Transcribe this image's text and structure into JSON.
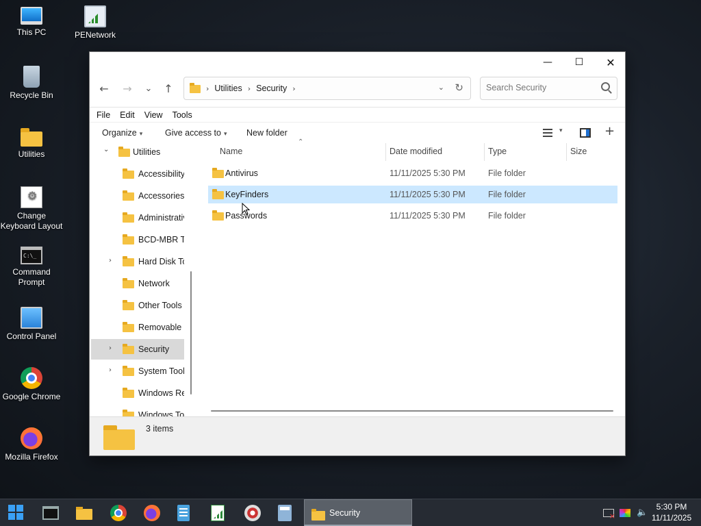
{
  "desktop": {
    "icons": [
      {
        "label": "This PC",
        "icon": "computer-icon"
      },
      {
        "label": "PENetwork",
        "icon": "network-icon"
      },
      {
        "label": "Recycle Bin",
        "icon": "recycle-bin-icon"
      },
      {
        "label": "Utilities",
        "icon": "folder-icon"
      },
      {
        "label": "Change Keyboard Layout",
        "icon": "keyboard-settings-icon"
      },
      {
        "label": "Command Prompt",
        "icon": "command-prompt-icon"
      },
      {
        "label": "Control Panel",
        "icon": "control-panel-icon"
      },
      {
        "label": "Google Chrome",
        "icon": "chrome-icon"
      },
      {
        "label": "Mozilla Firefox",
        "icon": "firefox-icon"
      }
    ]
  },
  "window": {
    "controls": {
      "minimize": "—",
      "maximize": "☐",
      "close": "✕"
    },
    "nav": {
      "back": "←",
      "forward": "→",
      "recent": "⌄",
      "up": "↑"
    },
    "address": {
      "crumbs": [
        "Utilities",
        "Security"
      ],
      "separator": "›"
    },
    "search": {
      "placeholder": "Search Security",
      "value": ""
    },
    "menu": [
      "File",
      "Edit",
      "View",
      "Tools"
    ],
    "commands": {
      "organize": "Organize",
      "give_access": "Give access to",
      "new_folder": "New folder"
    },
    "tree": {
      "items": [
        {
          "label": "Utilities",
          "level": 0,
          "expander": "⌄",
          "selected": false
        },
        {
          "label": "Accessibility",
          "level": 1,
          "expander": "",
          "selected": false
        },
        {
          "label": "Accessories",
          "level": 1,
          "expander": "",
          "selected": false
        },
        {
          "label": "Administrative Tools",
          "level": 1,
          "expander": "",
          "selected": false
        },
        {
          "label": "BCD-MBR Tools",
          "level": 1,
          "expander": "",
          "selected": false
        },
        {
          "label": "Hard Disk Tools",
          "level": 1,
          "expander": "›",
          "selected": false
        },
        {
          "label": "Network",
          "level": 1,
          "expander": "",
          "selected": false
        },
        {
          "label": "Other Tools",
          "level": 1,
          "expander": "",
          "selected": false
        },
        {
          "label": "Removable Drives",
          "level": 1,
          "expander": "",
          "selected": false
        },
        {
          "label": "Security",
          "level": 1,
          "expander": "›",
          "selected": true
        },
        {
          "label": "System Tools",
          "level": 1,
          "expander": "›",
          "selected": false
        },
        {
          "label": "Windows Recovery",
          "level": 1,
          "expander": "",
          "selected": false
        },
        {
          "label": "Windows Tools",
          "level": 1,
          "expander": "",
          "selected": false
        }
      ]
    },
    "columns": {
      "name": "Name",
      "date": "Date modified",
      "type": "Type",
      "size": "Size"
    },
    "files": [
      {
        "name": "Antivirus",
        "date": "11/11/2025 5:30 PM",
        "type": "File folder",
        "size": "",
        "hover": false
      },
      {
        "name": "KeyFinders",
        "date": "11/11/2025 5:30 PM",
        "type": "File folder",
        "size": "",
        "hover": true
      },
      {
        "name": "Passwords",
        "date": "11/11/2025 5:30 PM",
        "type": "File folder",
        "size": "",
        "hover": false
      }
    ],
    "status": {
      "item_count": "3 items"
    }
  },
  "taskbar": {
    "apps": [
      "start-icon",
      "command-prompt-icon",
      "file-explorer-icon",
      "chrome-icon",
      "firefox-icon",
      "notepad-icon",
      "chart-icon",
      "disk-icon",
      "calculator-icon"
    ],
    "active_task": "Security",
    "clock": {
      "time": "5:30 PM",
      "date": "11/11/2025"
    }
  }
}
